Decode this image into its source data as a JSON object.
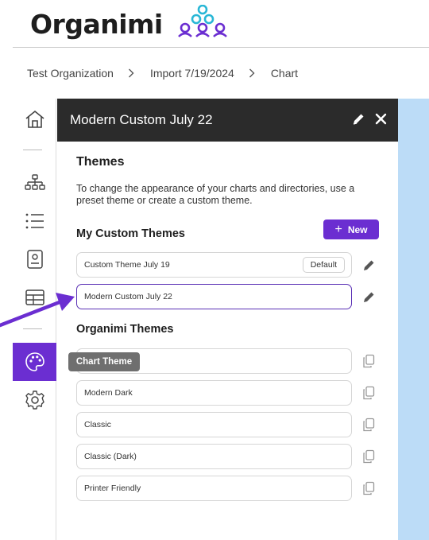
{
  "logo": {
    "text": "Organimi",
    "mark_color_primary": "#6b2ed1",
    "mark_color_accent": "#2ab7d6"
  },
  "breadcrumb": {
    "items": [
      "Test Organization",
      "Import 7/19/2024",
      "Chart"
    ]
  },
  "nav": {
    "items": [
      "home-icon",
      "org-chart-icon",
      "list-icon",
      "directory-icon",
      "table-icon",
      "palette-icon",
      "gear-icon"
    ],
    "active": "palette-icon",
    "tooltip": "Chart Theme"
  },
  "panel": {
    "title": "Modern Custom July 22",
    "section_title": "Themes",
    "description": "To change the appearance of your charts and directories, use a preset theme or create a custom theme.",
    "my_custom_title": "My Custom Themes",
    "new_button": "New",
    "custom_themes": [
      {
        "name": "Custom Theme July 19",
        "badge": "Default"
      },
      {
        "name": "Modern Custom July 22"
      }
    ],
    "organimi_title": "Organimi Themes",
    "organimi_themes": [
      "",
      "Modern Dark",
      "Classic",
      "Classic (Dark)",
      "Printer Friendly"
    ]
  },
  "colors": {
    "accent": "#6b2ed1",
    "header_bg": "#2b2b2b",
    "canvas_bg": "#bcdcf7"
  }
}
